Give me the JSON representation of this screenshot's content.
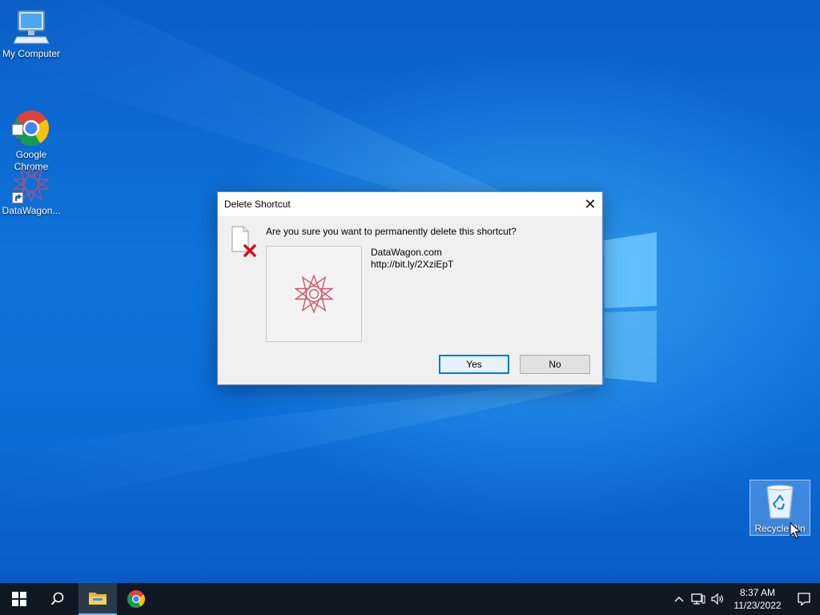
{
  "desktop": {
    "icons": [
      {
        "label": "My Computer"
      },
      {
        "label": "Google\nChrome"
      },
      {
        "label": "DataWagon..."
      },
      {
        "label": "Recycle Bin"
      }
    ]
  },
  "dialog": {
    "title": "Delete Shortcut",
    "close_label": "✕",
    "question": "Are you sure you want to permanently delete this shortcut?",
    "item_name": "DataWagon.com",
    "item_url": "http://bit.ly/2XziEpT",
    "yes_label": "Yes",
    "no_label": "No"
  },
  "taskbar": {
    "time": "8:37 AM",
    "date": "11/23/2022",
    "tray_chevron": "^"
  },
  "colors": {
    "accent": "#0078d7",
    "taskbar": "#101923",
    "wallpaper": "#0b6bd6"
  }
}
